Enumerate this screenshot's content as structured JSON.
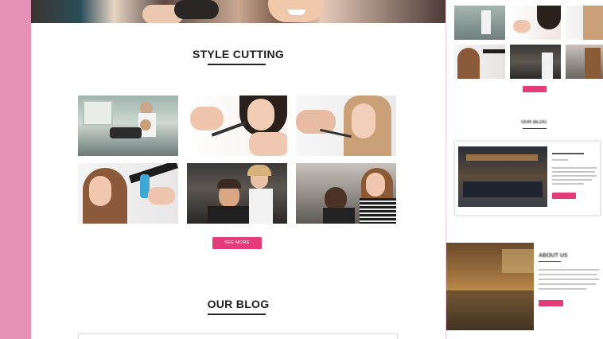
{
  "main": {
    "style_section": {
      "title": "STYLE CUTTING",
      "button_label": "SEE MORE"
    },
    "blog_section": {
      "title": "OUR BLOG"
    },
    "gallery": [
      {
        "name": "salon-interior-photo"
      },
      {
        "name": "scissors-cutting-photo"
      },
      {
        "name": "comb-trim-photo"
      },
      {
        "name": "hair-straightener-photo"
      },
      {
        "name": "barber-styling-photo"
      },
      {
        "name": "stylist-client-photo"
      }
    ]
  },
  "side": {
    "blog_title": "OUR BLOG",
    "about_title": "ABOUT US"
  },
  "colors": {
    "accent": "#e23d79",
    "sidebar": "#e592b5"
  }
}
